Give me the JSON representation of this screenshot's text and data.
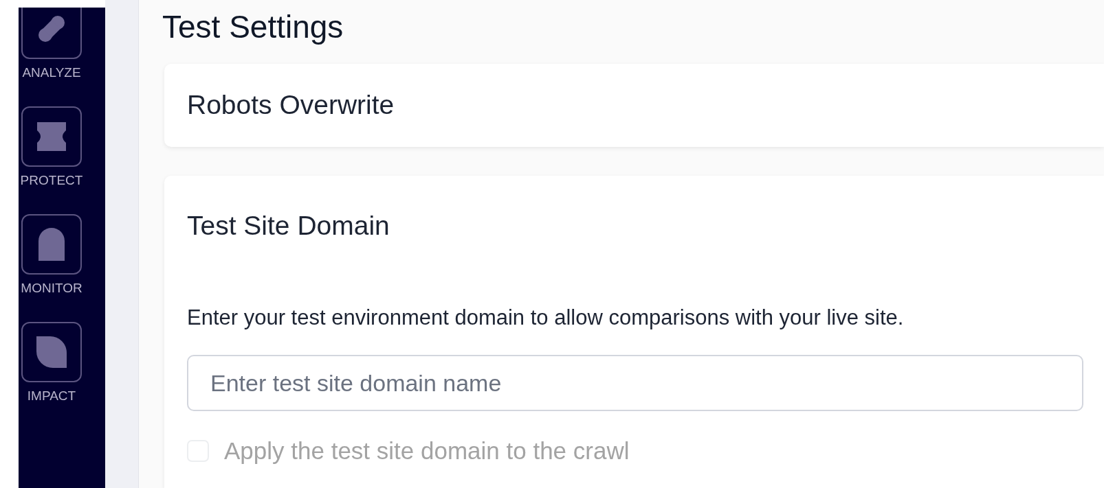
{
  "sidebar": {
    "items": [
      {
        "kind": "analyze",
        "label": "ANALYZE",
        "selected": false
      },
      {
        "kind": "protect",
        "label": "PROTECT",
        "selected": false
      },
      {
        "kind": "monitor",
        "label": "MONITOR",
        "selected": false
      },
      {
        "kind": "impact",
        "label": "IMPACT",
        "selected": false
      }
    ]
  },
  "page_title": "Test Settings",
  "sections": [
    {
      "title": "Robots Overwrite"
    },
    {
      "title": "Test Site Domain",
      "description": "Enter your test environment domain to allow comparisons with your live site.",
      "input": {
        "placeholder": "Enter test site domain name"
      },
      "checkbox": {
        "label": "Apply the test site domain to the crawl",
        "checked": false,
        "disabled": true
      }
    }
  ]
}
